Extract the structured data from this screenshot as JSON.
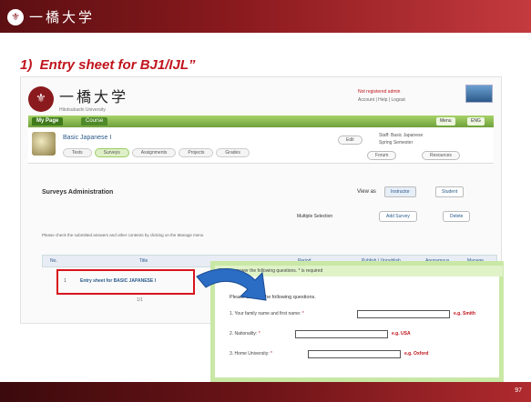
{
  "slide": {
    "top_logo": "一橋大学",
    "emblem": "⚜",
    "title": "1)  Entry sheet for BJ1/IJL”",
    "page_number": "97"
  },
  "screenshot": {
    "site_name": "一橋大学",
    "site_sub": "Hitotsubashi University",
    "login_line1": "Not registered admin",
    "login_line2": "Account | Help | Logout",
    "nav": {
      "mypage": "My Page",
      "course": "Course",
      "right1": "Menu",
      "right2": "ENG"
    },
    "course": {
      "name": "Basic Japanese I",
      "tabs": [
        "Tests",
        "Surveys",
        "Assignments",
        "Projects",
        "Grades"
      ],
      "active_tab": "Surveys",
      "info_line1": "Staff: Basic Japanese",
      "info_line2": "Spring Semester",
      "edit_btn": "Edit",
      "btn1": "Forum",
      "btn2": "Resources"
    },
    "surveys": {
      "title": "Surveys Administration",
      "view_label": "View as",
      "btn_instructor": "Instructor",
      "btn_student": "Student",
      "multiple_label": "Multiple Selection",
      "add_btn": "Add Survey",
      "delete_btn": "Delete",
      "instruction": "Please check the submitted answers and other contents by clicking on the Manage menu"
    },
    "table": {
      "headers": [
        "No.",
        "Title",
        "Period",
        "Publish / Unpublish",
        "Anonymous",
        "Manage"
      ],
      "row_num": "1",
      "row_title": "Entry sheet for BASIC JAPANESE I",
      "row_extra": "1/1"
    }
  },
  "popup": {
    "header": "Please answer the following questions. * is required",
    "intro": "Please answer the following questions.",
    "questions": [
      {
        "label": "1. Your family name and first name:",
        "note": "e.g. Smith"
      },
      {
        "label": "2. Nationality:",
        "note": "e.g. USA"
      },
      {
        "label": "3. Home University:",
        "note": "e.g. Oxford"
      }
    ],
    "required_mark": "*"
  }
}
